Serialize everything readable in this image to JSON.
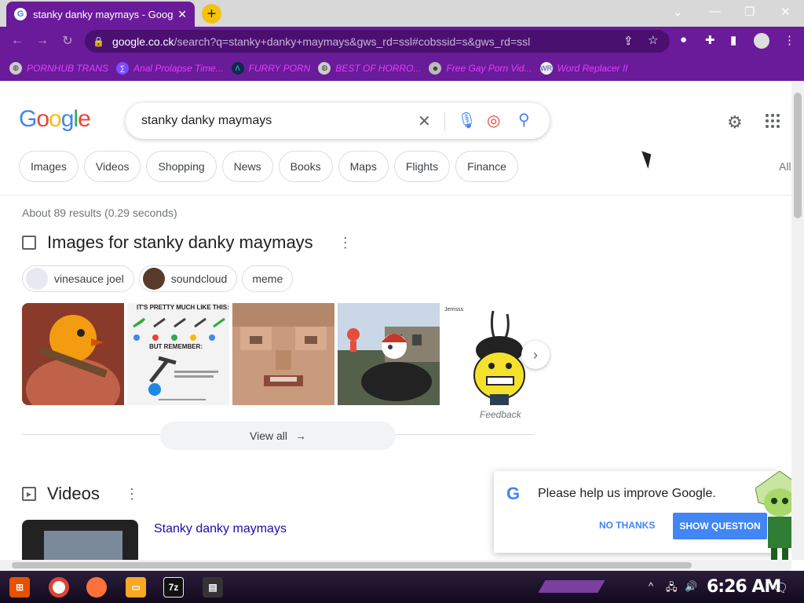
{
  "browser": {
    "tab_title": "stanky danky maymays - Google",
    "tab_close": "✕",
    "new_tab": "+",
    "url_host": "google.co.ck",
    "url_rest": "/search?q=stanky+danky+maymays&gws_rd=ssl#cobssid=s&gws_rd=ssl",
    "window_controls": [
      "⌄",
      "—",
      "❐",
      "✕"
    ]
  },
  "bookmarks": [
    {
      "label": "PORNHUB TRANS",
      "icon": "globe-icon"
    },
    {
      "label": "Anal Prolapse Time...",
      "icon": "bookmark-icon"
    },
    {
      "label": "FURRY PORN",
      "icon": "lambda-icon"
    },
    {
      "label": "BEST OF HORRO...",
      "icon": "globe-icon"
    },
    {
      "label": "Free Gay Porn Vid...",
      "icon": "face-icon"
    },
    {
      "label": "Word Replacer II",
      "icon": "wr-icon"
    }
  ],
  "google": {
    "logo": "Google",
    "search_value": "stanky danky maymays",
    "tabs": [
      "Images",
      "Videos",
      "Shopping",
      "News",
      "Books",
      "Maps",
      "Flights",
      "Finance"
    ],
    "all_label": "All",
    "stats": "About 89 results (0.29 seconds)",
    "images_heading": "Images for stanky danky maymays",
    "image_chips": [
      "vinesauce joel",
      "soundcloud",
      "meme"
    ],
    "feedback": "Feedback",
    "view_all": "View all",
    "videos_heading": "Videos",
    "video_link": "Stanky danky maymays",
    "image2_top": "IT'S PRETTY MUCH LIKE THIS:",
    "image2_mid": "BUT REMEMBER:",
    "image5_label": "Jerrisss"
  },
  "popup": {
    "text": "Please help us improve Google.",
    "no_thanks": "NO THANKS",
    "show_question": "SHOW QUESTION"
  },
  "taskbar": {
    "clock": "6:26 AM",
    "sevenzip": "7z"
  },
  "colors": {
    "chrome_purple": "#6a1b9a",
    "bookmark_text": "#e040fb",
    "google_blue": "#4285f4",
    "link": "#1a0dab"
  }
}
